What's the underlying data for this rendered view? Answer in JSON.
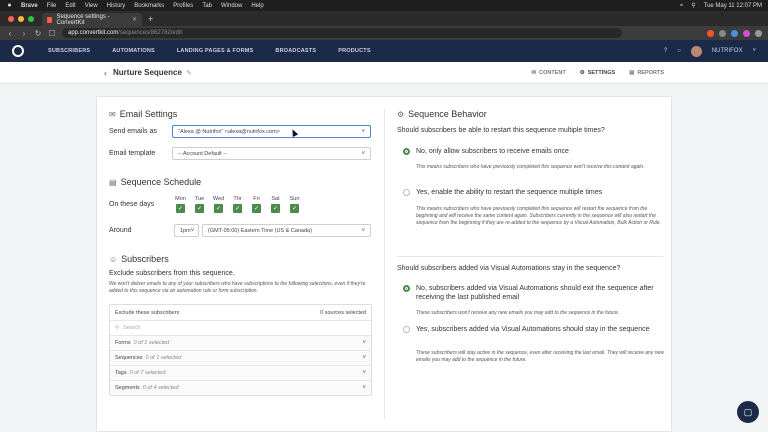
{
  "os_menubar": {
    "apple": "",
    "items": [
      "Brave",
      "File",
      "Edit",
      "View",
      "History",
      "Bookmarks",
      "Profiles",
      "Tab",
      "Window",
      "Help"
    ],
    "clock": "Tue May 11  12:07 PM"
  },
  "browser": {
    "tab_title": "Sequence settings - ConvertKit",
    "url_host": "app.convertkit.com",
    "url_path": "/sequences/862782/edit"
  },
  "app_nav": {
    "items": [
      "SUBSCRIBERS",
      "AUTOMATIONS",
      "LANDING PAGES & FORMS",
      "BROADCASTS",
      "PRODUCTS"
    ],
    "help": "?",
    "account": "NUTRIFOX"
  },
  "sequence_header": {
    "name": "Nurture Sequence",
    "tabs": [
      "CONTENT",
      "SETTINGS",
      "REPORTS"
    ],
    "active_tab": "SETTINGS"
  },
  "email_settings": {
    "title": "Email Settings",
    "send_as_label": "Send emails as",
    "send_as_value": "\"Alexa @ Nutrifox\" <alexa@nutrifox.com>",
    "template_label": "Email template",
    "template_value": "-- Account Default --"
  },
  "schedule": {
    "title": "Sequence Schedule",
    "days_label": "On these days",
    "days": [
      "Mon",
      "Tue",
      "Wed",
      "Thr",
      "Fri",
      "Sat",
      "Sun"
    ],
    "around_label": "Around",
    "time_value": "1pm",
    "timezone_value": "(GMT-05:00) Eastern Time (US & Canada)"
  },
  "subscribers": {
    "title": "Subscribers",
    "exclude_heading": "Exclude subscribers from this sequence.",
    "exclude_help": "We won't deliver emails to any of your subscribers who have subscriptions to the following selections, even if they're added to this sequence via an automation rule or form subscription.",
    "box_label": "Exclude these subscribers",
    "sources_count": "0 sources selected",
    "search_placeholder": "Search",
    "groups": [
      {
        "name": "Forms",
        "count": "0 of 1 selected"
      },
      {
        "name": "Sequences",
        "count": "0 of 1 selected"
      },
      {
        "name": "Tags",
        "count": "0 of 7 selected"
      },
      {
        "name": "Segments",
        "count": "0 of 4 selected"
      }
    ]
  },
  "behavior": {
    "title": "Sequence Behavior",
    "restart_question": "Should subscribers be able to restart this sequence multiple times?",
    "restart_opt1": "No, only allow subscribers to receive emails once",
    "restart_opt1_help": "This means subscribers who have previously completed this sequence won't receive this content again.",
    "restart_opt2": "Yes, enable the ability to restart the sequence multiple times",
    "restart_opt2_help": "This means subscribers who have previously completed this sequence will restart the sequence from the beginning and will receive the same content again. Subscribers currently in the sequence will also restart the sequence from the beginning if they are re-added to the sequence by a Visual Automation, Bulk Action or Rule.",
    "va_question": "Should subscribers added via Visual Automations stay in the sequence?",
    "va_opt1": "No, subscribers added via Visual Automations should exit the sequence after receiving the last published email",
    "va_opt1_help": "These subscribers won't receive any new emails you may add to the sequence in the future.",
    "va_opt2": "Yes, subscribers added via Visual Automations should stay in the sequence",
    "va_opt2_help": "These subscribers will stay active in the sequence, even after receiving the last email. They will receive any new emails you may add to the sequence in the future."
  },
  "colors": {
    "nav_bg": "#1c2a4a",
    "accent_green": "#4c8a4e",
    "focus_blue": "#3d8bd9"
  }
}
